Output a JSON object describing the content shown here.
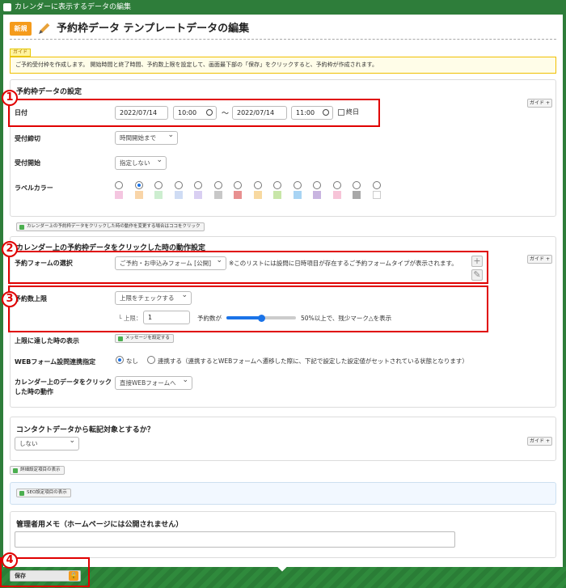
{
  "window": {
    "title": "カレンダーに表示するデータの編集"
  },
  "header": {
    "badge": "新規",
    "title": "予約枠データ テンプレートデータの編集"
  },
  "guide": {
    "tag": "ガイド",
    "text": "ご予約受付枠を作成します。 開始時間と終了時間、予約数上限を設定して、画面最下部の「保存」をクリックすると、予約枠が作成されます。"
  },
  "section1": {
    "title": "予約枠データの設定",
    "guide_btn": "ガイド +",
    "date_label": "日付",
    "start_date": "2022/07/14",
    "start_time": "10:00",
    "tilde": "〜",
    "end_date": "2022/07/14",
    "end_time": "11:00",
    "allday_label": "終日",
    "deadline_label": "受付締切",
    "deadline_value": "時間開始まで",
    "start_label": "受付開始",
    "start_value": "指定しない",
    "color_label": "ラベルカラー",
    "colors": [
      "#f4c6e0",
      "#f9d5a8",
      "#cdeed0",
      "#cfdcf4",
      "#d9cff2",
      "#c8c8c8",
      "#e89090",
      "#f8d9a0",
      "#c8e6a8",
      "#a8d4f4",
      "#c8b4e0",
      "#f7c4d8",
      "#a8a8a8",
      "#ffffff"
    ],
    "selected_color_index": 1,
    "note_btn": "カレンダー上の予約枠データをクリックした時の動作を変更する場合はココをクリック"
  },
  "section2": {
    "title": "カレンダー上の予約枠データをクリックした時の動作設定",
    "guide_btn": "ガイド +",
    "form_label": "予約フォームの選択",
    "form_value": "ご予約・お申込みフォーム [公開]",
    "form_note": "※このリストには設問に日時項目が存在するご予約フォームタイプが表示されます。",
    "limit_label": "予約数上限",
    "limit_select": "上限をチェックする",
    "limit_prefix": "└ 上限：",
    "limit_value": "1",
    "ratio_label": "予約数が",
    "ratio_value": 50,
    "ratio_text": "50%以上で、残少マーク△を表示",
    "reach_label": "上限に達した時の表示",
    "reach_btn": "メッセージを設定する",
    "web_label": "WEBフォーム設問連携指定",
    "web_none": "なし",
    "web_link": "連携する（連携するとWEBフォームへ遷移した際に、下記で設定した設定値がセットされている状態となります）",
    "click_label_1": "カレンダー上のデータをクリック",
    "click_label_2": "した時の動作",
    "click_value": "直接WEBフォームへ"
  },
  "section3": {
    "title": "コンタクトデータから転記対象とするか？",
    "value": "しない",
    "guide_btn": "ガイド +"
  },
  "detail_btn": "詳細設定項目の表示",
  "seo_btn": "SEO設定項目の表示",
  "memo": {
    "title": "管理者用メモ（ホームページには公開されません）"
  },
  "save": {
    "label": "保存"
  },
  "callouts": [
    "1",
    "2",
    "3",
    "4"
  ],
  "accent": "#2e7d3a",
  "highlight": "#e00000"
}
